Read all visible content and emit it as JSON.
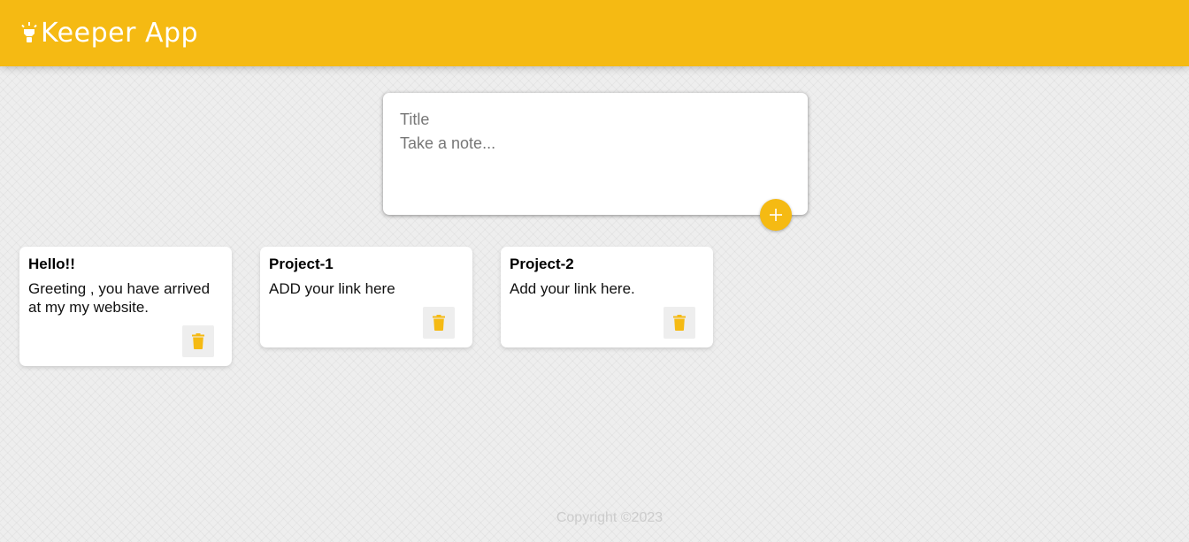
{
  "header": {
    "title": "Keeper App",
    "icon": "lightbulb-icon",
    "color": "#f5ba13"
  },
  "composer": {
    "title_placeholder": "Title",
    "title_value": "",
    "content_placeholder": "Take a note...",
    "content_value": "",
    "add_icon": "plus-icon"
  },
  "notes": [
    {
      "title": "Hello!!",
      "content": "Greeting , you have arrived at my my website.",
      "delete_icon": "trash-icon"
    },
    {
      "title": "Project-1",
      "content": "ADD your link here",
      "delete_icon": "trash-icon"
    },
    {
      "title": "Project-2",
      "content": "Add your link here.",
      "delete_icon": "trash-icon"
    }
  ],
  "footer": {
    "copyright": "Copyright ©2023"
  },
  "colors": {
    "accent": "#f5ba13",
    "background": "#eeeeee",
    "footer_text": "#cccccc"
  }
}
